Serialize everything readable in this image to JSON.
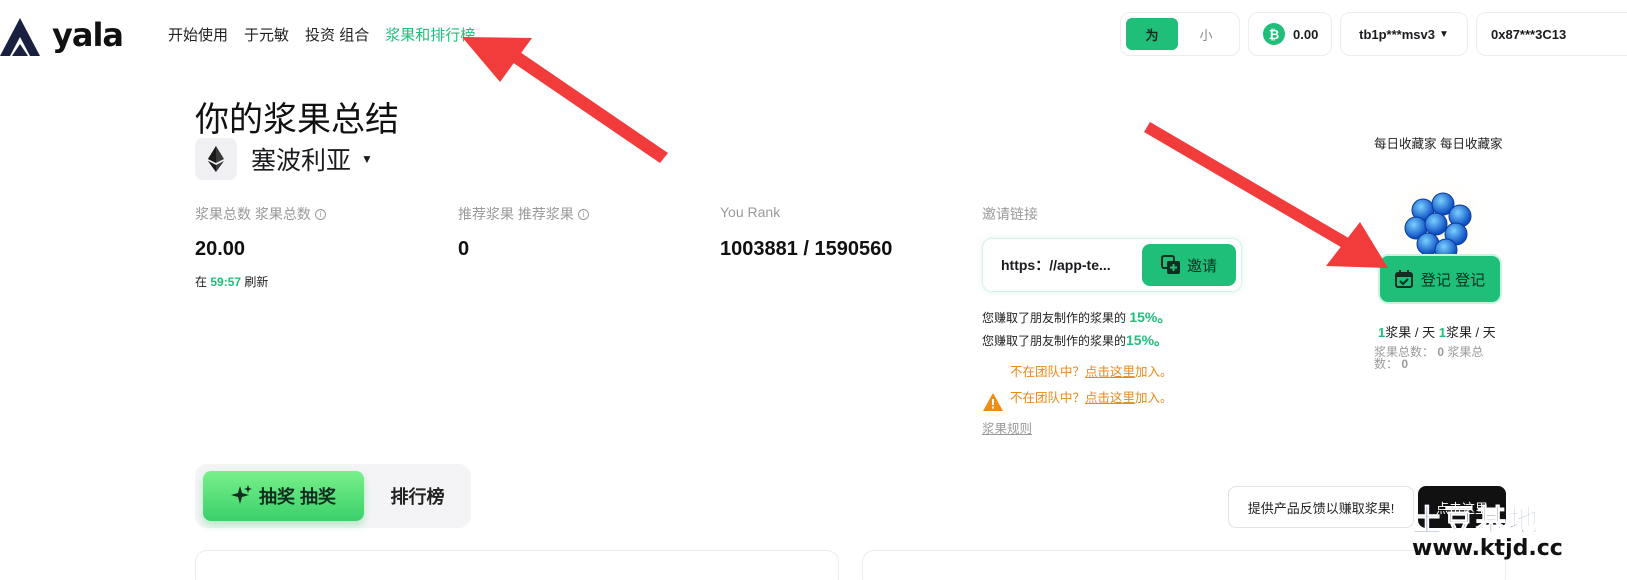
{
  "header": {
    "brand": "yala",
    "nav": [
      "开始使用",
      "于元敏",
      "投资 组合",
      "浆果和排行榜"
    ],
    "toggle": {
      "on": "为",
      "off": "小"
    },
    "btc_balance": "0.00",
    "btc_icon": "bitcoin-icon",
    "wallet_btc": "tb1p***msv3",
    "wallet_eth": "0x87***3C13"
  },
  "summary": {
    "title": "你的浆果总结",
    "chain": "塞波利亚",
    "stats": [
      {
        "label": "浆果总数  浆果总数",
        "value": "20.00"
      },
      {
        "label": "推荐浆果  推荐浆果",
        "value": "0"
      },
      {
        "label": "You Rank",
        "value": "1003881 / 1590560"
      }
    ],
    "refresh_prefix": "在",
    "refresh_time": "59:57",
    "refresh_suffix": "刷新"
  },
  "invite": {
    "label": "邀请链接",
    "url": "https：//app-te...",
    "button": "邀请",
    "earn_text": "您赚取了朋友制作的浆果的",
    "earn_pct": "15%。",
    "team_text": "不在团队中？",
    "team_link": "点击这里",
    "team_suffix": "加入。",
    "rules": "浆果规则"
  },
  "daily": {
    "title": "每日收藏家  每日收藏家",
    "checkin": "登记  登记",
    "rate_num": "1",
    "rate_text": "浆果 / 天",
    "total_label": "浆果总数：",
    "total_value": "0"
  },
  "tabs": {
    "active": "抽奖  抽奖",
    "inactive": "排行榜"
  },
  "footer": {
    "feedback": "提供产品反馈以赚取浆果!",
    "dark_button": "点击这里"
  },
  "watermark": {
    "top": "土豆基地",
    "bottom": "www.ktjd.cc"
  },
  "colors": {
    "accent": "#1fbf7a",
    "warning": "#e8891a",
    "arrow": "#f23b3b"
  }
}
